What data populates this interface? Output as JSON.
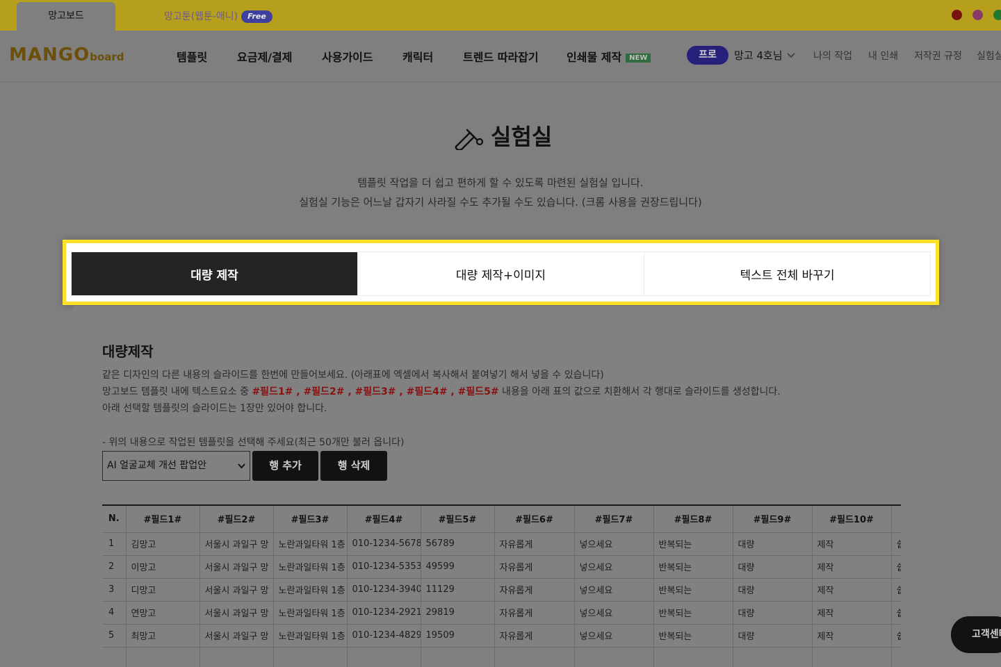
{
  "site_tabs": [
    {
      "label": "망고보드",
      "active": true
    },
    {
      "label": "망고툰(웹툰-애니)",
      "badge": "Free",
      "active": false
    }
  ],
  "social_icons": [
    "youtube-icon",
    "instagram-icon",
    "other-social-icon"
  ],
  "logo": {
    "main": "MANGO",
    "sub": "board"
  },
  "nav": {
    "items": [
      "템플릿",
      "요금제/결제",
      "사용가이드",
      "캐릭터",
      "트렌드 따라잡기",
      "인쇄물 제작"
    ],
    "new_badge": "NEW",
    "pro_badge": "프로",
    "user_name": "망고 4호님",
    "links": [
      "나의 작업",
      "내 인쇄",
      "저작권 규정",
      "실험실"
    ]
  },
  "lab": {
    "title": "실험실",
    "desc_line1": "템플릿 작업을 더 쉽고 편하게 할 수 있도록 마련된 실험실 입니다.",
    "desc_line2": "실험실 기능은 어느날 갑자기 사라질 수도 추가될 수도 있습니다. (크롬 사용을 권장드립니다)"
  },
  "tabs": [
    {
      "label": "대량 제작",
      "active": true
    },
    {
      "label": "대량 제작+이미지",
      "active": false
    },
    {
      "label": "텍스트 전체 바꾸기",
      "active": false
    }
  ],
  "bulk": {
    "title": "대량제작",
    "line1": "같은 디자인의 다른 내용의 슬라이드를 한번에 만들어보세요. (아래표에 엑셀에서 복사해서 붙여넣기 해서 넣을 수 있습니다)",
    "line2_prefix": "망고보드 템플릿 내에 텍스트요소 중 ",
    "fields": [
      "#필드1#",
      "#필드2#",
      "#필드3#",
      "#필드4#",
      "#필드5#"
    ],
    "field_sep": " , ",
    "line2_suffix": " 내용을 아래 표의 값으로 치환해서 각 행대로 슬라이드를 생성합니다.",
    "line3": "아래 선택할 템플릿의 슬라이드는 1장만 있어야 합니다.",
    "select_hint": "- 위의 내용으로 작업된 템플릿을 선택해 주세요(최근 50개만 불러 옵니다)",
    "select_value": "AI 얼굴교체 개선 팝업안",
    "add_row": "행 추가",
    "delete_row": "행 삭제"
  },
  "table": {
    "headers": [
      "N.",
      "#필드1#",
      "#필드2#",
      "#필드3#",
      "#필드4#",
      "#필드5#",
      "#필드6#",
      "#필드7#",
      "#필드8#",
      "#필드9#",
      "#필드10#",
      ""
    ],
    "rows": [
      [
        "1",
        "김망고",
        "서울시 과일구 망",
        "노란과일타워 1층",
        "010-1234-5678",
        "56789",
        "자유롭게",
        "넣으세요",
        "반복되는",
        "대량",
        "제작",
        "쉽"
      ],
      [
        "2",
        "이망고",
        "서울시 과일구 망",
        "노란과일타워 1층",
        "010-1234-5353",
        "49599",
        "자유롭게",
        "넣으세요",
        "반복되는",
        "대량",
        "제작",
        "쉽"
      ],
      [
        "3",
        "디망고",
        "서울시 과일구 망",
        "노란과일타워 1층",
        "010-1234-3940",
        "11129",
        "자유롭게",
        "넣으세요",
        "반복되는",
        "대량",
        "제작",
        "쉽"
      ],
      [
        "4",
        "연망고",
        "서울시 과일구 망",
        "노란과일타워 1층",
        "010-1234-2921",
        "29819",
        "자유롭게",
        "넣으세요",
        "반복되는",
        "대량",
        "제작",
        "쉽"
      ],
      [
        "5",
        "최망고",
        "서울시 과일구 망",
        "노란과일타워 1층",
        "010-1234-4829",
        "19509",
        "자유롭게",
        "넣으세요",
        "반복되는",
        "대량",
        "제작",
        "쉽"
      ]
    ]
  },
  "support_button": "고객센터"
}
